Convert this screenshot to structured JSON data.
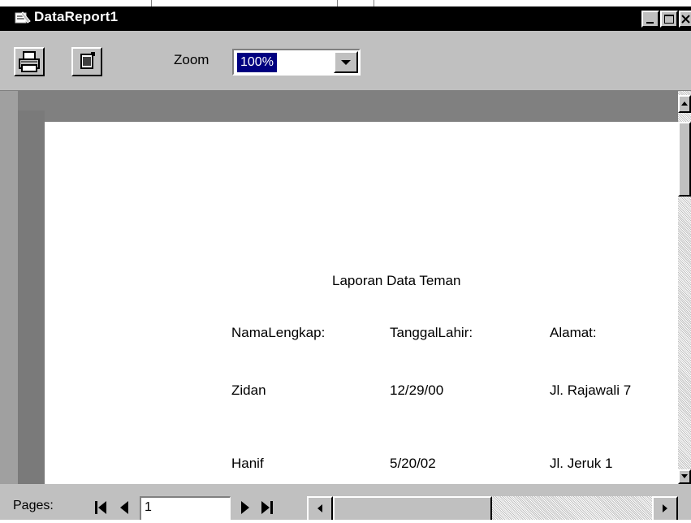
{
  "window": {
    "title": "DataReport1"
  },
  "toolbar": {
    "zoom_label": "Zoom",
    "zoom_value": "100%"
  },
  "report": {
    "title": "Laporan Data Teman",
    "columns": [
      "NamaLengkap:",
      "TanggalLahir:",
      "Alamat:"
    ],
    "rows": [
      [
        "Zidan",
        "12/29/00",
        "Jl. Rajawali 7"
      ],
      [
        "Hanif",
        "5/20/02",
        "Jl. Jeruk 1"
      ]
    ]
  },
  "pager": {
    "label": "Pages:",
    "current_page": "1"
  },
  "icons": {
    "app": "report-icon",
    "print": "printer-icon",
    "close_view": "page-close-icon",
    "first": "first-page-icon",
    "prev": "prev-page-icon",
    "next": "next-page-icon",
    "last": "last-page-icon"
  },
  "colors": {
    "titlebar": "#000000",
    "chrome": "#c0c0c0",
    "preview_bg": "#808080",
    "selection": "#000080"
  }
}
